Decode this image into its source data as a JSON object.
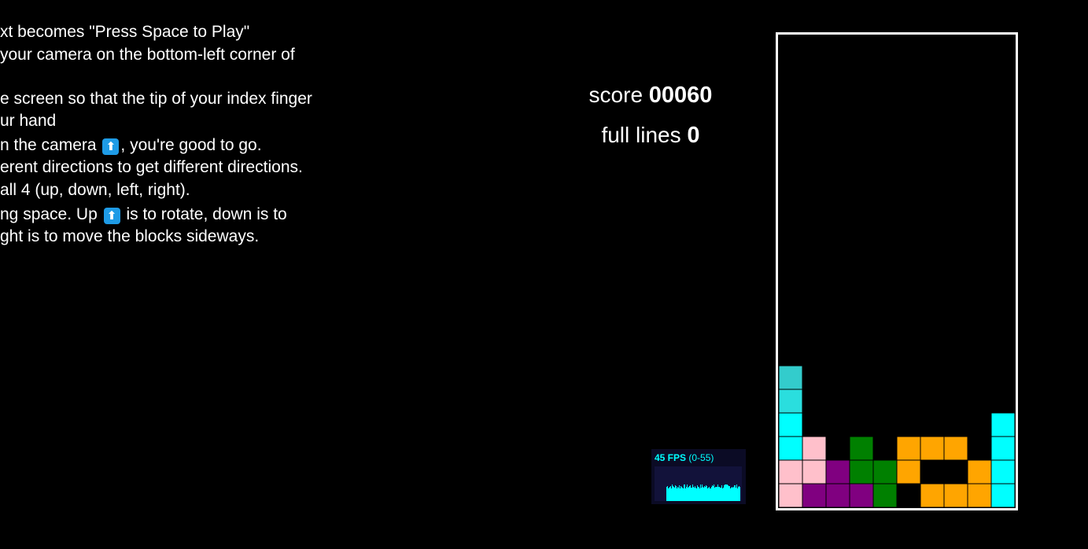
{
  "instructions": {
    "lines": [
      "xt becomes \"Press Space to Play\"",
      "your camera on the bottom-left corner of",
      "e screen so that the tip of your index finger",
      "ur hand",
      "n the camera",
      ", you're good to go.",
      "erent directions to get different directions.",
      "all 4 (up, down, left, right).",
      "ng space. Up",
      "is to rotate, down is to",
      "ght is to move the blocks sideways."
    ],
    "arrow_icon": "up-arrow-emoji-icon",
    "arrow_glyph": "⬆"
  },
  "score": {
    "label": "score",
    "value": "00060"
  },
  "full_lines": {
    "label": "full lines",
    "value": "0"
  },
  "fps": {
    "value": "45 FPS",
    "range": "(0-55)",
    "current": 45,
    "min": 0,
    "max": 55,
    "color": "#00ffff"
  },
  "board": {
    "columns": 10,
    "rows": 20,
    "colors": {
      "C": "#00ffff",
      "c": "#2adede",
      "d": "#33cccc",
      "P": "#ffc0cb",
      "V": "#800080",
      "G": "#008000",
      "O": "#ffa500",
      "border": "#ffffff",
      "cell_line": "#000000"
    },
    "grid": [
      "..........",
      "..........",
      "..........",
      "..........",
      "..........",
      "..........",
      "..........",
      "..........",
      "..........",
      "..........",
      "..........",
      "..........",
      "..........",
      "..........",
      "d.........",
      "c.........",
      "C........C",
      "CP.G.OOO.C",
      "PPVGGO..OC",
      "PVVVG.OOOC"
    ]
  }
}
